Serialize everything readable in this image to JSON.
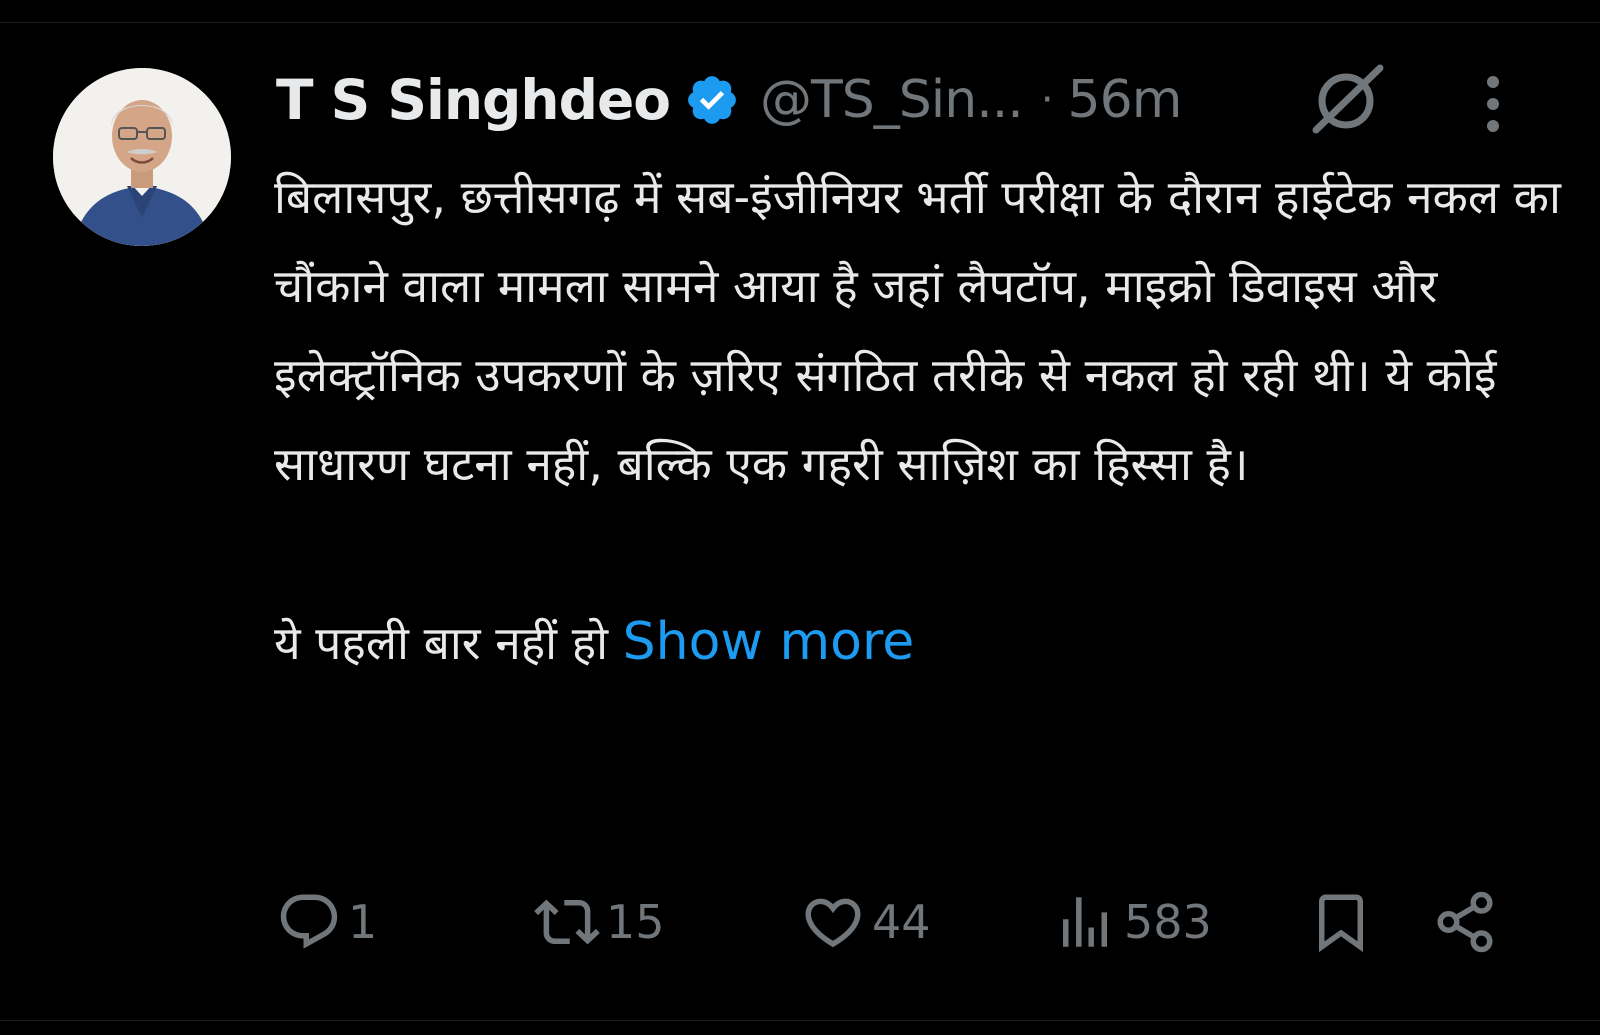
{
  "tweet": {
    "author": {
      "display_name": "T S Singhdeo",
      "handle": "@TS_Sin...",
      "verified_color": "#1d9bf0"
    },
    "separator": "·",
    "time": "56m",
    "icons": {
      "verified": "verified-badge-icon",
      "grok": "grok-icon",
      "more": "more-options-icon"
    },
    "body": {
      "paragraph1": "बिलासपुर, छत्तीसगढ़ में सब-इंजीनियर भर्ती परीक्षा के दौरान हाईटेक नकल का चौंकाने वाला मामला सामने आया है जहां लैपटॉप, माइक्रो डिवाइस और इलेक्ट्रॉनिक उपकरणों के ज़रिए संगठित तरीके से नकल हो रही थी। ये कोई साधारण घटना नहीं, बल्कि एक गहरी साज़िश का हिस्सा है।",
      "paragraph2": "ये पहली बार नहीं हो",
      "show_more": "Show more"
    },
    "actions": {
      "replies": "1",
      "reposts": "15",
      "likes": "44",
      "views": "583"
    },
    "colors": {
      "background": "#000000",
      "text": "#e7e9ea",
      "muted": "#71767b",
      "link": "#1d9bf0"
    }
  }
}
